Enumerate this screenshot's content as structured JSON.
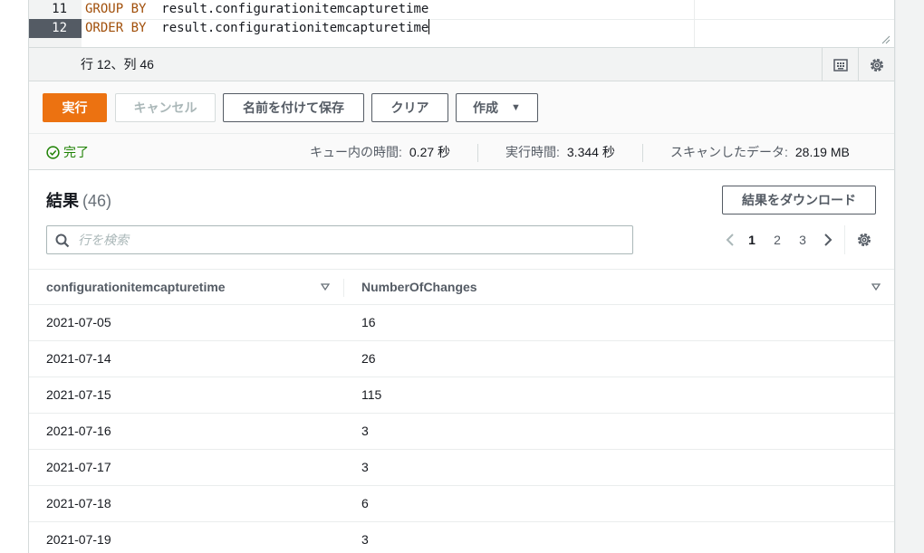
{
  "editor": {
    "lines": [
      {
        "number": "11",
        "keyword": "GROUP BY",
        "expression": "result.configurationitemcapturetime"
      },
      {
        "number": "12",
        "keyword": "ORDER BY",
        "expression": "result.configurationitemcapturetime"
      }
    ],
    "cursor_position": "行 12、列 46"
  },
  "actions": {
    "run_label": "実行",
    "cancel_label": "キャンセル",
    "save_as_label": "名前を付けて保存",
    "clear_label": "クリア",
    "create_label": "作成"
  },
  "stats": {
    "status": "完了",
    "queue_time_label": "キュー内の時間:",
    "queue_time_value": "0.27 秒",
    "run_time_label": "実行時間:",
    "run_time_value": "3.344 秒",
    "scanned_label": "スキャンしたデータ:",
    "scanned_value": "28.19 MB"
  },
  "results": {
    "title": "結果",
    "count": "(46)",
    "download_label": "結果をダウンロード",
    "search_placeholder": "行を検索",
    "pages": [
      "1",
      "2",
      "3"
    ],
    "current_page": "1",
    "columns": [
      "configurationitemcapturetime",
      "NumberOfChanges"
    ],
    "rows": [
      [
        "2021-07-05",
        "16"
      ],
      [
        "2021-07-14",
        "26"
      ],
      [
        "2021-07-15",
        "115"
      ],
      [
        "2021-07-16",
        "3"
      ],
      [
        "2021-07-17",
        "3"
      ],
      [
        "2021-07-18",
        "6"
      ],
      [
        "2021-07-19",
        "3"
      ]
    ]
  },
  "colors": {
    "primary": "#ec7211",
    "success": "#1d8102",
    "keyword": "#a14f0a",
    "active_gutter": "#545b64"
  }
}
